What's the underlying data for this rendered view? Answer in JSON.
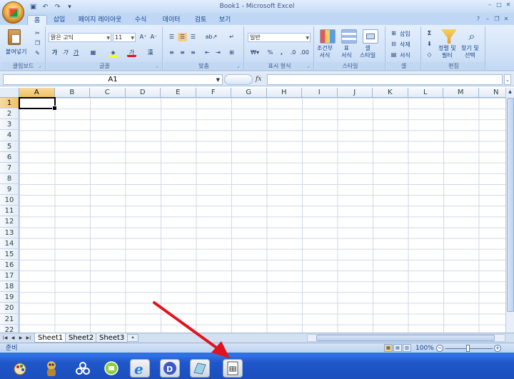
{
  "window": {
    "title": "Book1 - Microsoft Excel"
  },
  "qat": {
    "save": "▣",
    "undo": "↶",
    "redo": "↷",
    "custom": "▾"
  },
  "tabs": [
    "홈",
    "삽입",
    "페이지 레이아웃",
    "수식",
    "데이터",
    "검토",
    "보기"
  ],
  "ribbon": {
    "clipboard": {
      "label": "클립보드",
      "paste": "붙여넣기"
    },
    "font": {
      "label": "글꼴",
      "name": "맑은 고딕",
      "size": "11",
      "bold": "가",
      "italic": "가",
      "underline": "가"
    },
    "align": {
      "label": "맞춤"
    },
    "number": {
      "label": "표시 형식",
      "format": "일반",
      "percent": "%",
      "comma": ","
    },
    "styles": {
      "label": "스타일",
      "cond": "조건부\n서식",
      "table": "표\n서식",
      "cell": "셀\n스타일"
    },
    "cells": {
      "label": "셀",
      "insert": "삽입",
      "delete": "삭제",
      "format": "서식"
    },
    "edit": {
      "label": "편집",
      "sortfilter": "정렬 및\n필터",
      "findselect": "찾기 및\n선택"
    }
  },
  "formula": {
    "namebox": "A1",
    "fx": "fx"
  },
  "columns": [
    "A",
    "B",
    "C",
    "D",
    "E",
    "F",
    "G",
    "H",
    "I",
    "J",
    "K",
    "L",
    "M",
    "N"
  ],
  "rows": [
    "1",
    "2",
    "3",
    "4",
    "5",
    "6",
    "7",
    "8",
    "9",
    "10",
    "11",
    "12",
    "13",
    "14",
    "15",
    "16",
    "17",
    "18",
    "19",
    "20",
    "21",
    "22"
  ],
  "sheets": [
    "Sheet1",
    "Sheet2",
    "Sheet3"
  ],
  "status": {
    "ready": "준비",
    "zoom": "100%"
  },
  "colors": {
    "accent": "#15428b",
    "arrow": "#e0141e"
  }
}
